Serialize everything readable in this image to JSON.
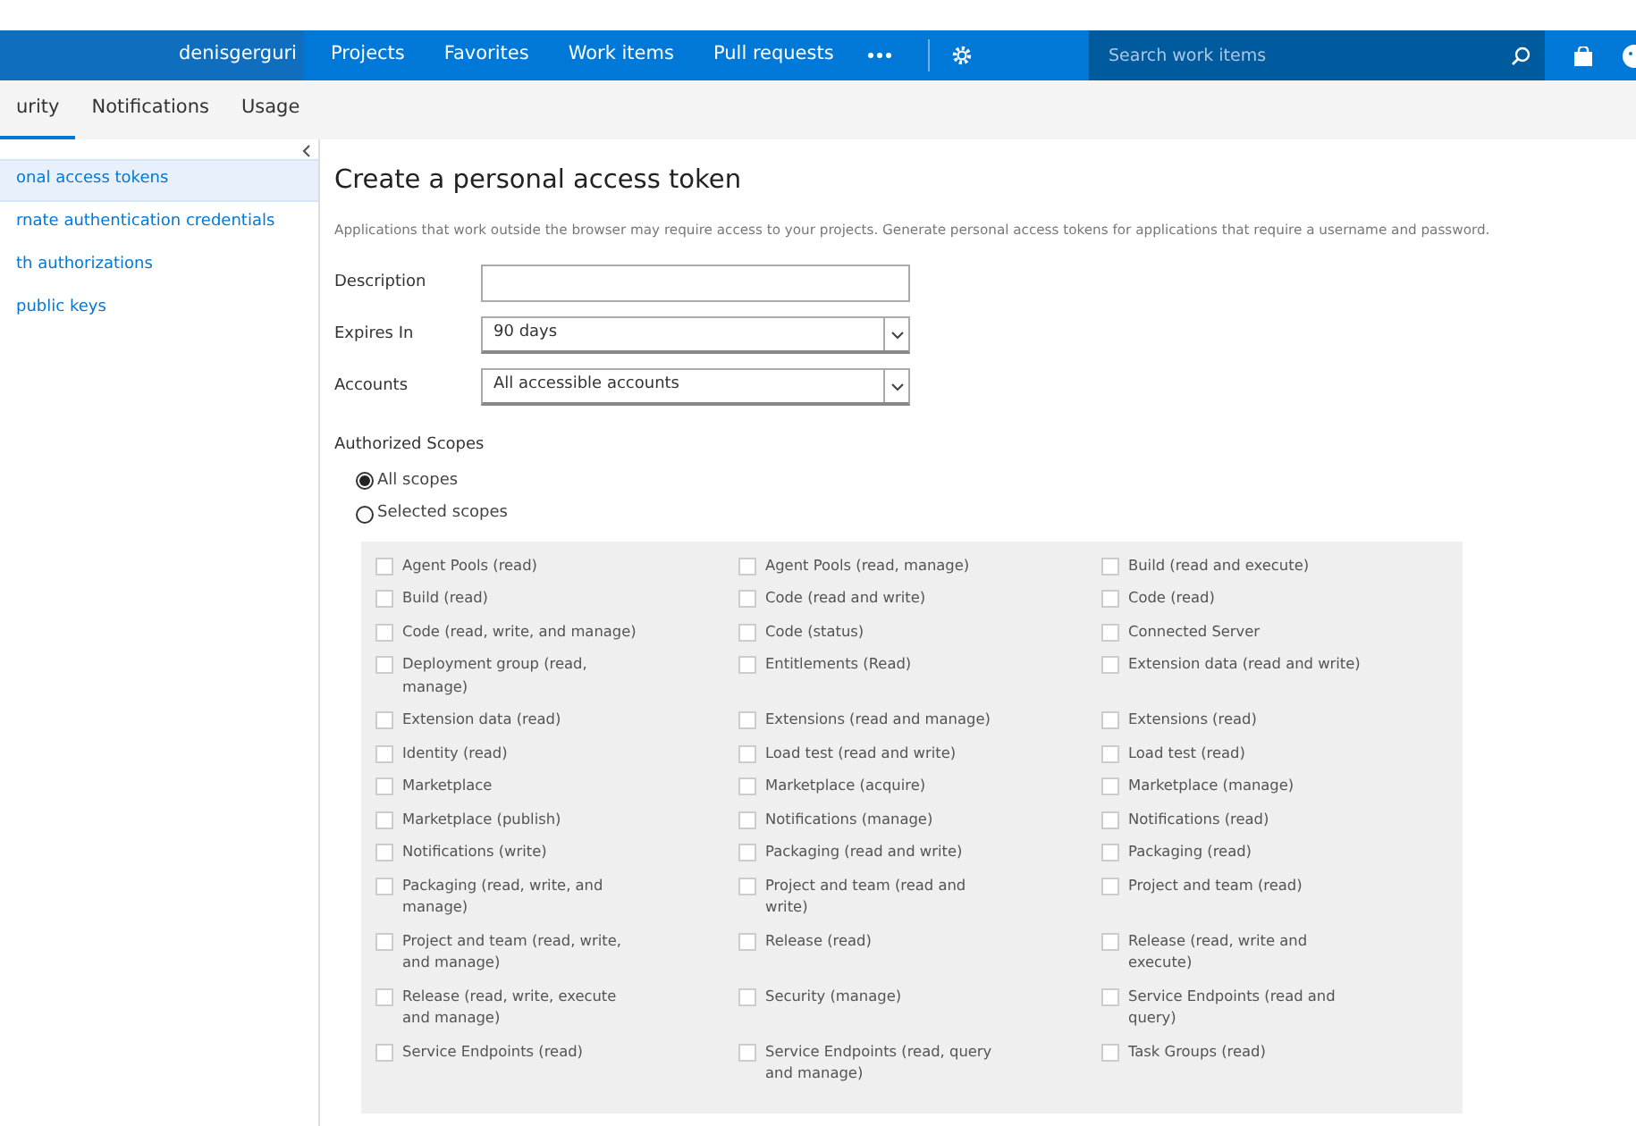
{
  "header": {
    "account": "denisgerguri",
    "nav": [
      {
        "label": "Projects"
      },
      {
        "label": "Favorites"
      },
      {
        "label": "Work items"
      },
      {
        "label": "Pull requests"
      }
    ],
    "search": {
      "placeholder": "Search work items"
    }
  },
  "tabs": [
    {
      "label": "urity",
      "selected": true
    },
    {
      "label": "Notifications",
      "selected": false
    },
    {
      "label": "Usage",
      "selected": false
    }
  ],
  "sidebar": {
    "items": [
      {
        "label": "onal access tokens",
        "selected": true
      },
      {
        "label": "rnate authentication credentials",
        "selected": false
      },
      {
        "label": "th authorizations",
        "selected": false
      },
      {
        "label": "public keys",
        "selected": false
      }
    ]
  },
  "form": {
    "title": "Create a personal access token",
    "description": "Applications that work outside the browser may require access to your projects. Generate personal access tokens for applications that require a username and password.",
    "fields": [
      {
        "label": "Description",
        "kind": "text"
      },
      {
        "label": "Expires In",
        "kind": "select",
        "value": "90 days"
      },
      {
        "label": "Accounts",
        "kind": "select",
        "value": "All accessible accounts"
      }
    ]
  },
  "scopes": {
    "title": "Authorized Scopes",
    "options": [
      {
        "label": "All scopes",
        "selected": true
      },
      {
        "label": "Selected scopes",
        "selected": false
      }
    ],
    "items": [
      {
        "label": "Agent Pools (read)",
        "checked": false
      },
      {
        "label": "Agent Pools (read, manage)",
        "checked": false
      },
      {
        "label": "Build (read and execute)",
        "checked": false
      },
      {
        "label": "Build (read)",
        "checked": false
      },
      {
        "label": "Code (read and write)",
        "checked": false
      },
      {
        "label": "Code (read)",
        "checked": false
      },
      {
        "label": "Code (read, write, and manage)",
        "checked": false
      },
      {
        "label": "Code (status)",
        "checked": false
      },
      {
        "label": "Connected Server",
        "checked": false
      },
      {
        "label": "Deployment group (read, manage)",
        "checked": false
      },
      {
        "label": "Entitlements (Read)",
        "checked": false
      },
      {
        "label": "Extension data (read and write)",
        "checked": false
      },
      {
        "label": "Extension data (read)",
        "checked": false
      },
      {
        "label": "Extensions (read and manage)",
        "checked": false
      },
      {
        "label": "Extensions (read)",
        "checked": false
      },
      {
        "label": "Identity (read)",
        "checked": false
      },
      {
        "label": "Load test (read and write)",
        "checked": false
      },
      {
        "label": "Load test (read)",
        "checked": false
      },
      {
        "label": "Marketplace",
        "checked": false
      },
      {
        "label": "Marketplace (acquire)",
        "checked": false
      },
      {
        "label": "Marketplace (manage)",
        "checked": false
      },
      {
        "label": "Marketplace (publish)",
        "checked": false
      },
      {
        "label": "Notifications (manage)",
        "checked": false
      },
      {
        "label": "Notifications (read)",
        "checked": false
      },
      {
        "label": "Notifications (write)",
        "checked": false
      },
      {
        "label": "Packaging (read and write)",
        "checked": false
      },
      {
        "label": "Packaging (read)",
        "checked": false
      },
      {
        "label": "Packaging (read, write, and manage)",
        "checked": false
      },
      {
        "label": "Project and team (read and write)",
        "checked": false
      },
      {
        "label": "Project and team (read)",
        "checked": false
      },
      {
        "label": "Project and team (read, write, and manage)",
        "checked": false
      },
      {
        "label": "Release (read)",
        "checked": false
      },
      {
        "label": "Release (read, write and execute)",
        "checked": false
      },
      {
        "label": "Release (read, write, execute and manage)",
        "checked": false
      },
      {
        "label": "Security (manage)",
        "checked": false
      },
      {
        "label": "Service Endpoints (read and query)",
        "checked": false
      },
      {
        "label": "Service Endpoints (read)",
        "checked": false
      },
      {
        "label": "Service Endpoints (read, query and manage)",
        "checked": false
      },
      {
        "label": "Task Groups (read)",
        "checked": false
      }
    ]
  }
}
